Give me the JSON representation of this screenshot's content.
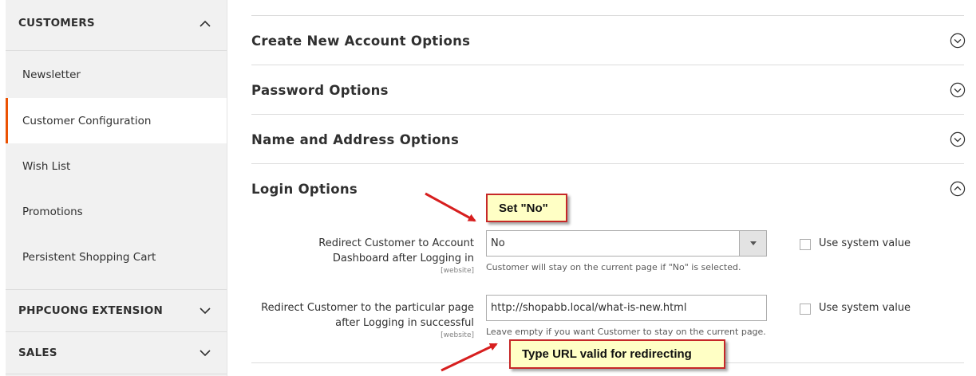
{
  "sidebar": {
    "customers_header": "CUSTOMERS",
    "items": [
      {
        "label": "Newsletter"
      },
      {
        "label": "Customer Configuration"
      },
      {
        "label": "Wish List"
      },
      {
        "label": "Promotions"
      },
      {
        "label": "Persistent Shopping Cart"
      }
    ],
    "phpcuong_header": "PHPCUONG EXTENSION",
    "sales_header": "SALES",
    "active_item": "Customer Configuration",
    "accent_color": "#eb5202"
  },
  "groups": [
    {
      "title": "Create New Account Options",
      "expanded": false
    },
    {
      "title": "Password Options",
      "expanded": false
    },
    {
      "title": "Name and Address Options",
      "expanded": false
    },
    {
      "title": "Login Options",
      "expanded": true
    }
  ],
  "login_options": {
    "redirect_dashboard": {
      "label_line1": "Redirect Customer to Account",
      "label_line2": "Dashboard after Logging in",
      "scope": "[website]",
      "value": "No",
      "note": "Customer will stay on the current page if \"No\" is selected.",
      "use_system_label": "Use system value",
      "use_system_checked": false
    },
    "redirect_url": {
      "label_line1": "Redirect Customer to the particular page",
      "label_line2": "after Logging in successful",
      "scope": "[website]",
      "value": "http://shopabb.local/what-is-new.html",
      "note": "Leave empty if you want Customer to stay on the current page.",
      "use_system_label": "Use system value",
      "use_system_checked": false
    }
  },
  "annotations": {
    "callout_no": "Set \"No\"",
    "callout_url": "Type URL valid for redirecting",
    "color": "#c62828"
  }
}
